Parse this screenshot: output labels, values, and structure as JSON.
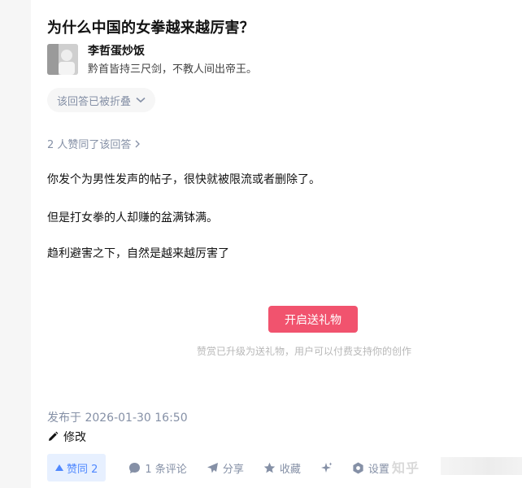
{
  "question": {
    "title": "为什么中国的女拳越来越厉害？"
  },
  "author": {
    "name": "李哲蛋炒饭",
    "bio": "黔首皆持三尺剑，不教人间出帝王。"
  },
  "fold_notice": "该回答已被折叠",
  "upvote_summary": "2 人赞同了该回答",
  "answer": {
    "paragraphs": [
      "你发个为男性发声的帖子，很快就被限流或者删除了。",
      "但是打女拳的人却赚的盆满钵满。",
      "趋利避害之下，自然是越来越厉害了"
    ]
  },
  "gift": {
    "button": "开启送礼物",
    "hint": "赞赏已升级为送礼物，用户可以付费支持你的创作"
  },
  "meta": {
    "published": "发布于 2026-01-30 16:50",
    "edit": "修改"
  },
  "actions": {
    "upvote": "赞同 2",
    "comments": "1 条评论",
    "share": "分享",
    "favorite": "收藏",
    "settings": "设置"
  },
  "watermark": "知乎",
  "colors": {
    "accent": "#f1536e",
    "vote_bg": "#e7f0ff",
    "vote_text": "#4f88ff",
    "muted": "#8590a6"
  }
}
